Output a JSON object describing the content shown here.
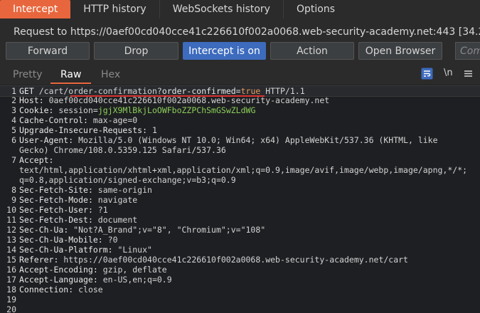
{
  "tabs": [
    "Intercept",
    "HTTP history",
    "WebSockets history",
    "Options"
  ],
  "request_label": "Request to https://0aef00cd040cce41c226610f002a0068.web-security-academy.net:443  [34.246.1",
  "buttons": {
    "forward": "Forward",
    "drop": "Drop",
    "intercept": "Intercept is on",
    "action": "Action",
    "open_browser": "Open Browser"
  },
  "comment_placeholder": "Comm",
  "view_tabs": [
    "Pretty",
    "Raw",
    "Hex"
  ],
  "view_icons": [
    "wrap-icon",
    "newline-icon",
    "menu-icon"
  ],
  "newline_label": "\\n",
  "request": {
    "line1": {
      "method": "GET",
      "path": "/cart/order-confirmation?",
      "param": "order-confirmed",
      "eq": "=",
      "value": "true",
      "proto": " HTTP/1.1"
    },
    "host": "0aef00cd040cce41c226610f002a0068.web-security-academy.net",
    "cookie_name": "session",
    "cookie_value": "jgjX9MlBkjLoOWFboZZPChSmGSwZLdWG",
    "headers": [
      {
        "n": "3",
        "k": "Cache-Control",
        "v": "max-age=0"
      },
      {
        "n": "4",
        "k": "Upgrade-Insecure-Requests",
        "v": "1"
      },
      {
        "n": "5",
        "k": "User-Agent",
        "v": "Mozilla/5.0 (Windows NT 10.0; Win64; x64) AppleWebKit/537.36 (KHTML, like"
      },
      {
        "n": "",
        "k": "",
        "v": "Gecko) Chrome/108.0.5359.125 Safari/537.36"
      },
      {
        "n": "6",
        "k": "Accept",
        "v": ""
      },
      {
        "n": "",
        "k": "",
        "v": "text/html,application/xhtml+xml,application/xml;q=0.9,image/avif,image/webp,image/apng,*/*;"
      },
      {
        "n": "",
        "k": "",
        "v": "q=0.8,application/signed-exchange;v=b3;q=0.9"
      },
      {
        "n": "7",
        "k": "Sec-Fetch-Site",
        "v": "same-origin"
      },
      {
        "n": "8",
        "k": "Sec-Fetch-Mode",
        "v": "navigate"
      },
      {
        "n": "9",
        "k": "Sec-Fetch-User",
        "v": "?1"
      },
      {
        "n": "10",
        "k": "Sec-Fetch-Dest",
        "v": "document"
      },
      {
        "n": "11",
        "k": "Sec-Ch-Ua",
        "v": "\"Not?A_Brand\";v=\"8\", \"Chromium\";v=\"108\""
      },
      {
        "n": "12",
        "k": "Sec-Ch-Ua-Mobile",
        "v": "?0"
      },
      {
        "n": "13",
        "k": "Sec-Ch-Ua-Platform",
        "v": "\"Linux\""
      },
      {
        "n": "14",
        "k": "Referer",
        "v": "https://0aef00cd040cce41c226610f002a0068.web-security-academy.net/cart"
      },
      {
        "n": "15",
        "k": "Accept-Encoding",
        "v": "gzip, deflate"
      },
      {
        "n": "16",
        "k": "Accept-Language",
        "v": "en-US,en;q=0.9"
      },
      {
        "n": "17",
        "k": "Connection",
        "v": "close"
      },
      {
        "n": "18",
        "k": "",
        "v": ""
      },
      {
        "n": "19",
        "k": "",
        "v": ""
      }
    ]
  },
  "colors": {
    "accent": "#e8663d",
    "intercept_on": "#3d6bbd",
    "cookie_value": "#8ccf5a",
    "underline": "#d9322e"
  }
}
